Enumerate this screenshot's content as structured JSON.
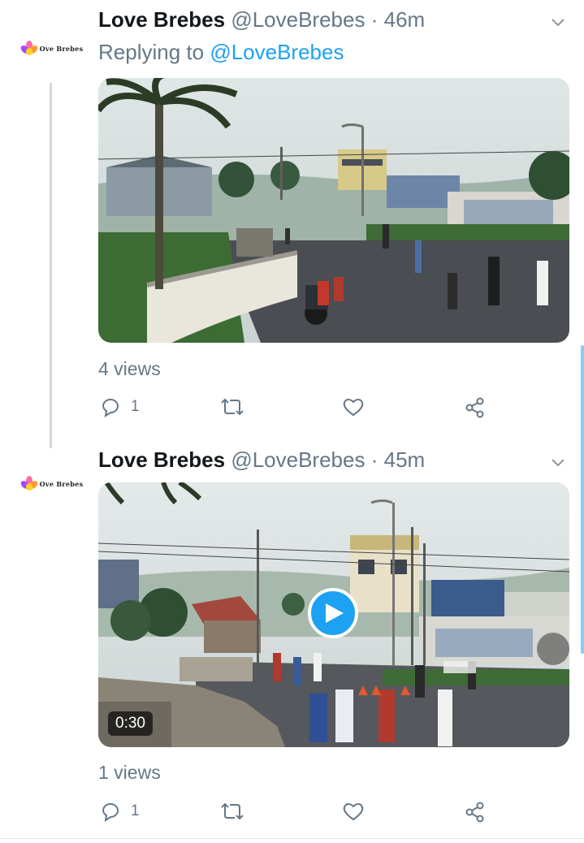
{
  "tweets": [
    {
      "author_name": "Love Brebes",
      "author_handle": "@LoveBrebes",
      "separator": "·",
      "time": "46m",
      "replying_prefix": "Replying to",
      "replying_handle": "@LoveBrebes",
      "views": "4 views",
      "reply_count": "1",
      "avatar_text": "Ove Brebes",
      "avatar_initial": "L"
    },
    {
      "author_name": "Love Brebes",
      "author_handle": "@LoveBrebes",
      "separator": "·",
      "time": "45m",
      "views": "1 views",
      "reply_count": "1",
      "video_duration": "0:30",
      "avatar_text": "Ove Brebes",
      "avatar_initial": "L"
    }
  ],
  "colors": {
    "accent": "#1da1f2",
    "text_secondary": "#657786",
    "text_primary": "#14171a"
  }
}
